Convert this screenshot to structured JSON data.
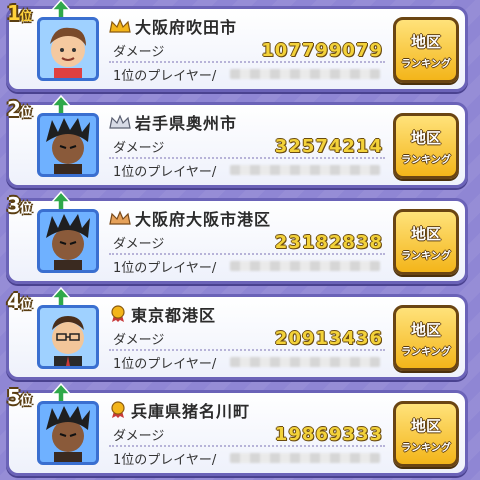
{
  "labels": {
    "damage": "ダメージ",
    "player_prefix": "1位のプレイヤー/",
    "region_line1": "地区",
    "region_line2": "ランキング",
    "rank_suffix": "位"
  },
  "colors": {
    "card_border": "#6b63b8",
    "button_fill": "#f3b51a",
    "damage_text": "#f3d23a",
    "arrow_green": "#2fa84a"
  },
  "entries": [
    {
      "rank": "1",
      "city": "大阪府吹田市",
      "damage": "107799079",
      "badge": "crown-gold-icon",
      "trend": "up-arrow-icon"
    },
    {
      "rank": "2",
      "city": "岩手県奥州市",
      "damage": "32574214",
      "badge": "crown-silver-icon",
      "trend": "up-arrow-icon"
    },
    {
      "rank": "3",
      "city": "大阪府大阪市港区",
      "damage": "23182838",
      "badge": "crown-bronze-icon",
      "trend": "up-arrow-icon"
    },
    {
      "rank": "4",
      "city": "東京都港区",
      "damage": "20913436",
      "badge": "ribbon-medal-icon",
      "trend": "up-arrow-icon"
    },
    {
      "rank": "5",
      "city": "兵庫県猪名川町",
      "damage": "19869333",
      "badge": "ribbon-medal-icon",
      "trend": "up-arrow-icon"
    }
  ]
}
